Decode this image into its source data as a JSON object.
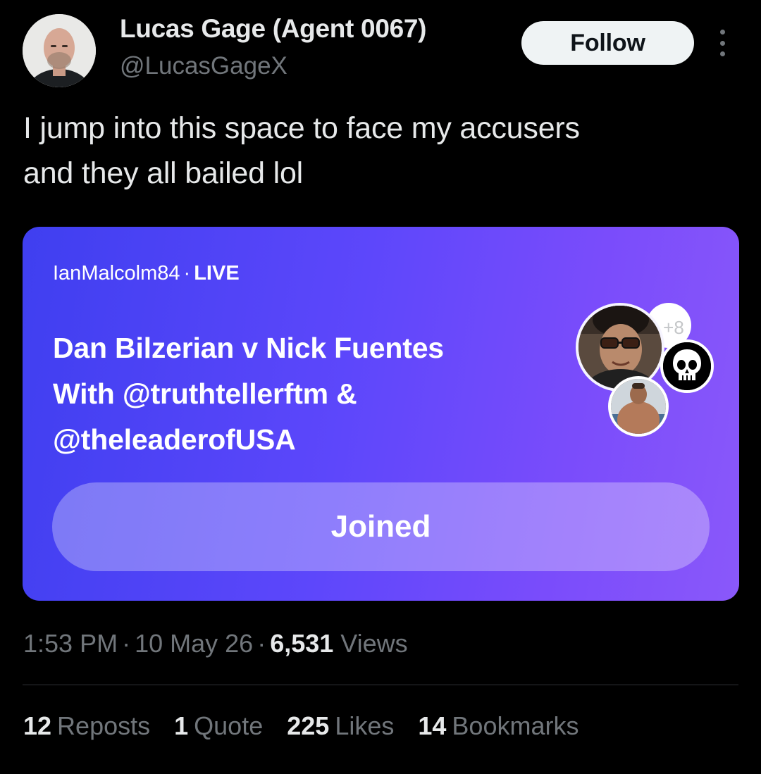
{
  "author": {
    "display_name": "Lucas Gage (Agent 0067)",
    "handle": "@LucasGageX",
    "follow_label": "Follow"
  },
  "tweet": {
    "text_line_1": "I jump into this space to face my accusers",
    "text_line_2": "and they all bailed lol"
  },
  "space": {
    "host": "IanMalcolm84",
    "separator": "·",
    "status": "LIVE",
    "title_line_1": "Dan Bilzerian v Nick Fuentes",
    "title_line_2": "With @truthtellerftm &",
    "title_line_3": "@theleaderofUSA",
    "extra_participants": "+8",
    "joined_label": "Joined",
    "colors": {
      "gradient_start": "#3f3ff0",
      "gradient_end": "#8a58fa"
    }
  },
  "meta": {
    "time": "1:53 PM",
    "separator": "·",
    "date": "10 May 26",
    "views_count": "6,531",
    "views_label": "Views"
  },
  "stats": [
    {
      "count": "12",
      "label": "Reposts"
    },
    {
      "count": "1",
      "label": "Quote"
    },
    {
      "count": "225",
      "label": "Likes"
    },
    {
      "count": "14",
      "label": "Bookmarks"
    }
  ],
  "icons": {
    "more": "more-vertical-icon",
    "avatar": "user-avatar",
    "skull": "skull-avatar"
  }
}
